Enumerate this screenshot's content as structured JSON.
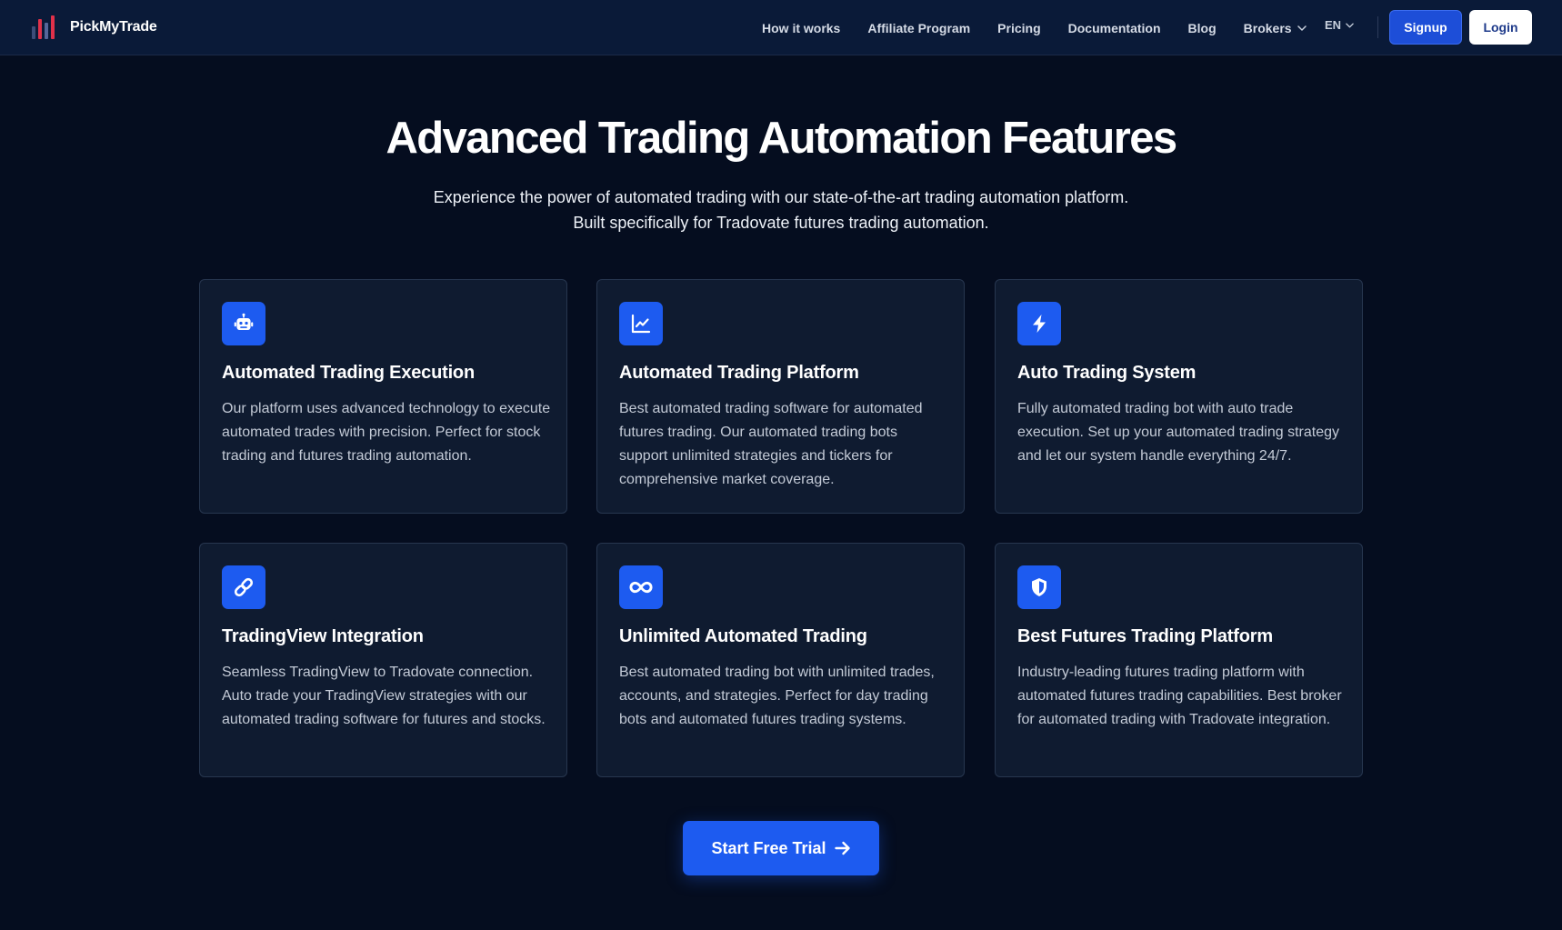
{
  "nav": {
    "brand": "PickMyTrade",
    "links": [
      "How it works",
      "Affiliate Program",
      "Pricing",
      "Documentation",
      "Blog",
      "Brokers"
    ],
    "language": "EN",
    "signup_label": "Signup",
    "login_label": "Login"
  },
  "hero": {
    "title": "Advanced Trading Automation Features",
    "subtitle": "Experience the power of automated trading with our state-of-the-art trading automation platform. Built specifically for Tradovate futures trading automation."
  },
  "features": [
    {
      "icon": "robot-icon",
      "title": "Automated Trading Execution",
      "description": "Our platform uses advanced technology to execute automated trades with precision. Perfect for stock trading and futures trading automation."
    },
    {
      "icon": "chart-line-icon",
      "title": "Automated Trading Platform",
      "description": "Best automated trading software for automated futures trading. Our automated trading bots support unlimited strategies and tickers for comprehensive market coverage."
    },
    {
      "icon": "bolt-icon",
      "title": "Auto Trading System",
      "description": "Fully automated trading bot with auto trade execution. Set up your automated trading strategy and let our system handle everything 24/7."
    },
    {
      "icon": "link-icon",
      "title": "TradingView Integration",
      "description": "Seamless TradingView to Tradovate connection. Auto trade your TradingView strategies with our automated trading software for futures and stocks."
    },
    {
      "icon": "infinity-icon",
      "title": "Unlimited Automated Trading",
      "description": "Best automated trading bot with unlimited trades, accounts, and strategies. Perfect for day trading bots and automated futures trading systems."
    },
    {
      "icon": "shield-icon",
      "title": "Best Futures Trading Platform",
      "description": "Industry-leading futures trading platform with automated futures trading capabilities. Best broker for automated trading with Tradovate integration."
    }
  ],
  "cta": {
    "label": "Start Free Trial"
  },
  "colors": {
    "background": "#050d1f",
    "navbar": "#0a1a38",
    "card": "#0f1b30",
    "accent": "#1d5bf0",
    "logo_red": "#e0314a"
  }
}
